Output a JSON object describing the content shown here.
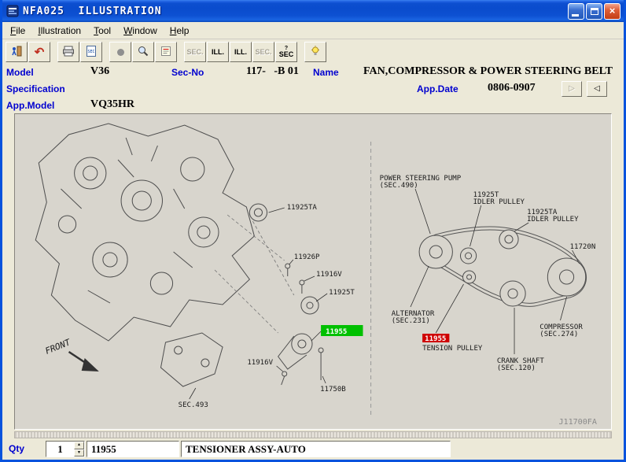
{
  "window": {
    "title": "NFA025  ILLUSTRATION",
    "close_glyph": "×"
  },
  "menu": {
    "items": [
      {
        "label": "File"
      },
      {
        "label": "Illustration"
      },
      {
        "label": "Tool"
      },
      {
        "label": "Window"
      },
      {
        "label": "Help"
      }
    ]
  },
  "toolbar": {
    "buttons": [
      {
        "name": "exit"
      },
      {
        "name": "undo",
        "glyph": "↶"
      },
      {
        "name": "print"
      },
      {
        "name": "sec-document",
        "label": "SEC"
      },
      {
        "name": "record",
        "glyph": "●"
      },
      {
        "name": "zoom"
      },
      {
        "name": "note"
      },
      {
        "name": "sec-prev",
        "label": "SEC.",
        "enabled": false
      },
      {
        "name": "ill-1",
        "label": "ILL.",
        "enabled": true
      },
      {
        "name": "ill-2",
        "label": "ILL.",
        "enabled": true
      },
      {
        "name": "sec-next",
        "label": "SEC.",
        "enabled": false
      },
      {
        "name": "sec-search",
        "label": "SEC",
        "sup": "?",
        "enabled": true
      },
      {
        "name": "help"
      }
    ]
  },
  "fields": {
    "model": {
      "label": "Model",
      "value": "V36"
    },
    "sec_no": {
      "label": "Sec-No",
      "value": "117-   -B 01"
    },
    "name": {
      "label": "Name",
      "value": "FAN,COMPRESSOR & POWER STEERING BELT"
    },
    "specification": {
      "label": "Specification"
    },
    "app_date": {
      "label": "App.Date",
      "value": "0806-0907"
    },
    "app_model": {
      "label": "App.Model",
      "value": "VQ35HR"
    }
  },
  "nav": {
    "forward": "▷",
    "back": "◁"
  },
  "illustration": {
    "left_labels": [
      {
        "text": "11925TA"
      },
      {
        "text": "11926P"
      },
      {
        "text": "11916V"
      },
      {
        "text": "11925T"
      },
      {
        "text": "11955",
        "highlight": "green"
      },
      {
        "text": "11916V"
      },
      {
        "text": "11750B"
      },
      {
        "text": "SEC.493"
      },
      {
        "text": "FRONT"
      }
    ],
    "right_labels": [
      {
        "line1": "POWER STEERING PUMP",
        "line2": "(SEC.490)"
      },
      {
        "line1": "11925T",
        "line2": "IDLER PULLEY"
      },
      {
        "line1": "11925TA",
        "line2": "IDLER PULLEY"
      },
      {
        "line1": "11720N"
      },
      {
        "line1": "ALTERNATOR",
        "line2": "(SEC.231)"
      },
      {
        "line1": "11955",
        "line2": "TENSION PULLEY",
        "highlight": "red"
      },
      {
        "line1": "COMPRESSOR",
        "line2": "(SEC.274)"
      },
      {
        "line1": "CRANK SHAFT",
        "line2": "(SEC.120)"
      }
    ],
    "figure_code": "J11700FA"
  },
  "status": {
    "qty_label": "Qty",
    "qty_value": "1",
    "part_number": "11955",
    "part_name": "TENSIONER ASSY-AUTO",
    "spin_up": "▲",
    "spin_down": "▼"
  },
  "colors": {
    "highlight_green": "#00c000",
    "highlight_red": "#cf0000",
    "label_blue": "#0000cf"
  }
}
